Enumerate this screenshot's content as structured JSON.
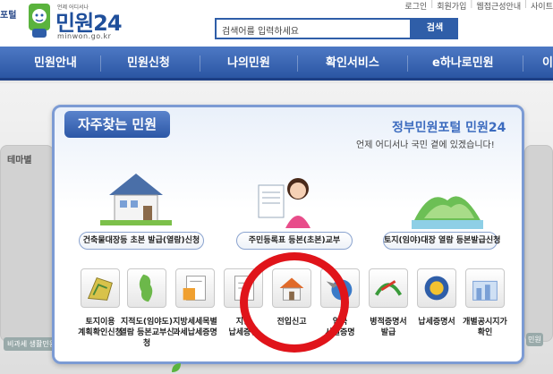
{
  "header": {
    "logo_left": "포털",
    "logo_small": "언제 어디서나",
    "logo_title": "민원24",
    "logo_url": "minwon.go.kr",
    "top_links": [
      "로그인",
      "회원가입",
      "웹접근성안내",
      "사이트"
    ],
    "search_placeholder": "검색어를 입력하세요",
    "search_button": "검색"
  },
  "nav": {
    "items": [
      "민원안내",
      "민원신청",
      "나의민원",
      "확인서비스",
      "e하나로민원",
      "이"
    ]
  },
  "side": {
    "left_top": "테마별",
    "left_foot": "비과세 생활민원",
    "right_foot": "민원"
  },
  "panel": {
    "tab_title": "자주찾는 민원",
    "slogan_title": "정부민원포털 민원24",
    "slogan_sub": "언제 어디서나 국민 곁에 있겠습니다!",
    "featured": [
      {
        "label": "건축물대장등 초본 발급(열람)신청"
      },
      {
        "label": "주민등록표 등본(초본)교부"
      },
      {
        "label": "토지(임야)대장 열람 등본발급신청"
      }
    ],
    "services": [
      {
        "line1": "토지이용",
        "line2": "계획확인신청"
      },
      {
        "line1": "지적도(임야도)",
        "line2": "열람 등본교부신청"
      },
      {
        "line1": "지방세세목별",
        "line2": "과세납세증명"
      },
      {
        "line1": "지방",
        "line2": "납세증명"
      },
      {
        "line1": "전입신고",
        "line2": ""
      },
      {
        "line1": "입국",
        "line2": "사실증명"
      },
      {
        "line1": "병적증명서",
        "line2": "발급"
      },
      {
        "line1": "납세증명서",
        "line2": ""
      },
      {
        "line1": "개별공시지가",
        "line2": "확인"
      }
    ]
  },
  "colors": {
    "brand_blue": "#2f5ea8",
    "nav_blue": "#2b56a3",
    "highlight_red": "#e0141a"
  },
  "icons": [
    "logo-emblem-icon",
    "house-icon",
    "girl-document-icon",
    "mountain-icon",
    "map-icon",
    "korea-map-icon",
    "tax-document-icon",
    "house-small-icon",
    "globe-plane-icon",
    "military-emblem-icon",
    "tax-badge-icon",
    "land-price-icon"
  ]
}
